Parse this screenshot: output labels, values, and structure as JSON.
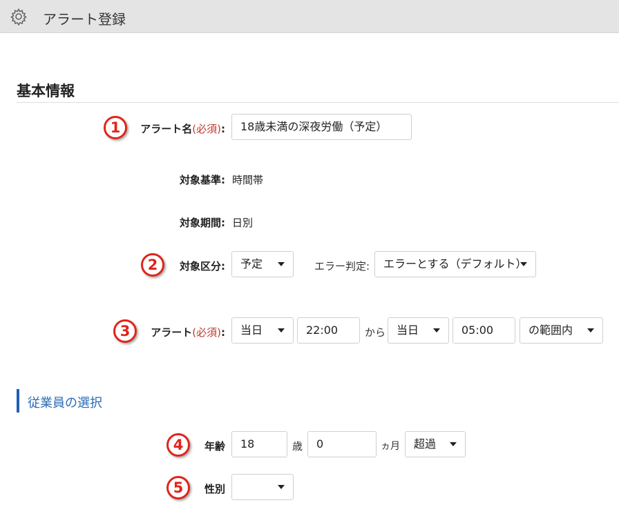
{
  "header": {
    "title": "アラート登録",
    "icon": "gear-icon"
  },
  "basic_info": {
    "section_title": "基本情報",
    "alert_name": {
      "label": "アラート名",
      "required": "(必須)",
      "colon": ":",
      "value": "18歳未満の深夜労働（予定）",
      "badge": "1"
    },
    "target_basis": {
      "label": "対象基準:",
      "value": "時間帯"
    },
    "target_period": {
      "label": "対象期間:",
      "value": "日別"
    },
    "target_category": {
      "label": "対象区分:",
      "value": "予定",
      "badge": "2"
    },
    "error_judgment": {
      "label": "エラー判定:",
      "value": "エラーとする（デフォルト）"
    },
    "alert": {
      "label": "アラート",
      "required": "(必須)",
      "colon": ":",
      "badge": "3",
      "from_day": "当日",
      "from_time": "22:00",
      "from_text": "から",
      "to_day": "当日",
      "to_time": "05:00",
      "range": "の範囲内"
    }
  },
  "employee_selection": {
    "section_title": "従業員の選択",
    "age": {
      "label": "年齢",
      "badge": "4",
      "years": "18",
      "years_unit": "歳",
      "months": "0",
      "months_unit": "ヵ月",
      "condition": "超過"
    },
    "gender": {
      "label": "性別",
      "badge": "5",
      "value": ""
    }
  },
  "colors": {
    "accent_blue": "#1e5fb5",
    "badge_red": "#e0241b",
    "required_red": "#c0392b",
    "header_gray": "#e4e4e4"
  }
}
